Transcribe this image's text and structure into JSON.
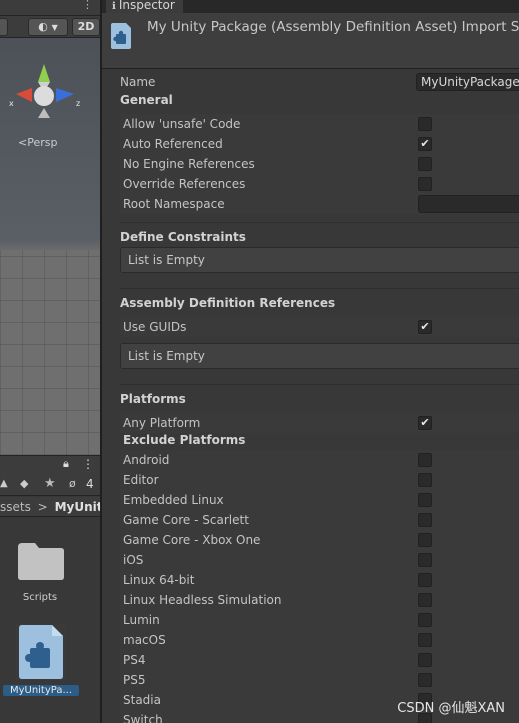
{
  "scene": {
    "toggle_2d": "2D",
    "persp_label": "<Persp"
  },
  "project": {
    "favorites_count": "4",
    "breadcrumb": [
      "ssets",
      ">",
      "MyUnityP"
    ],
    "assets": [
      {
        "label": "Scripts",
        "icon": "folder-icon"
      },
      {
        "label": "MyUnityPa...",
        "icon": "assembly-definition-icon"
      }
    ]
  },
  "inspector": {
    "tab_label": "Inspector",
    "title": "My Unity Package (Assembly Definition Asset) Import Settin",
    "name_label": "Name",
    "name_value": "MyUnityPackage",
    "general": {
      "heading": "General",
      "rows": [
        {
          "label": "Allow 'unsafe' Code",
          "checked": false
        },
        {
          "label": "Auto Referenced",
          "checked": true
        },
        {
          "label": "No Engine References",
          "checked": false
        },
        {
          "label": "Override References",
          "checked": false
        }
      ],
      "root_namespace_label": "Root Namespace",
      "root_namespace_value": ""
    },
    "define_constraints": {
      "heading": "Define Constraints",
      "list_text": "List is Empty"
    },
    "assembly_refs": {
      "heading": "Assembly Definition References",
      "use_guids_label": "Use GUIDs",
      "use_guids_checked": true,
      "list_text": "List is Empty"
    },
    "platforms": {
      "heading": "Platforms",
      "any_platform_label": "Any Platform",
      "any_platform_checked": true,
      "exclude_heading": "Exclude Platforms",
      "items": [
        "Android",
        "Editor",
        "Embedded Linux",
        "Game Core - Scarlett",
        "Game Core - Xbox One",
        "iOS",
        "Linux 64-bit",
        "Linux Headless Simulation",
        "Lumin",
        "macOS",
        "PS4",
        "PS5",
        "Stadia",
        "Switch"
      ]
    }
  },
  "watermark": "CSDN @仙魁XAN"
}
